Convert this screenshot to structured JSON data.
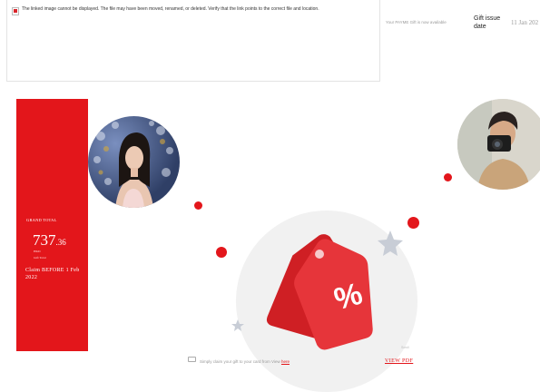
{
  "broken_image": {
    "message": "The linked image cannot be displayed.  The file may have been moved, renamed, or deleted. Verify that the link points to the correct file and location."
  },
  "header": {
    "availability_note": "Your PAYME Gift is now available",
    "issue_label": "Gift issue date",
    "issue_date": "11 Jan 202"
  },
  "panel": {
    "label": "GRAND TOTAL",
    "amount_main": "737",
    "amount_decimal": ".36",
    "amount_note_1": "HKD",
    "amount_note_2": "Gift Total",
    "claim_text": "Claim BEFORE 1 Feb 2022"
  },
  "badge": {
    "icon": "discount-tag-icon",
    "symbol": "%"
  },
  "footer": {
    "text": "Simply claim your gift to your card from View",
    "link_text": "here",
    "view_pdf": "VIEW PDF",
    "tiny_mark": "Scroll"
  },
  "colors": {
    "brand_red": "#e3161b",
    "tag_dark": "#d11f24",
    "background": "#ffffff"
  }
}
